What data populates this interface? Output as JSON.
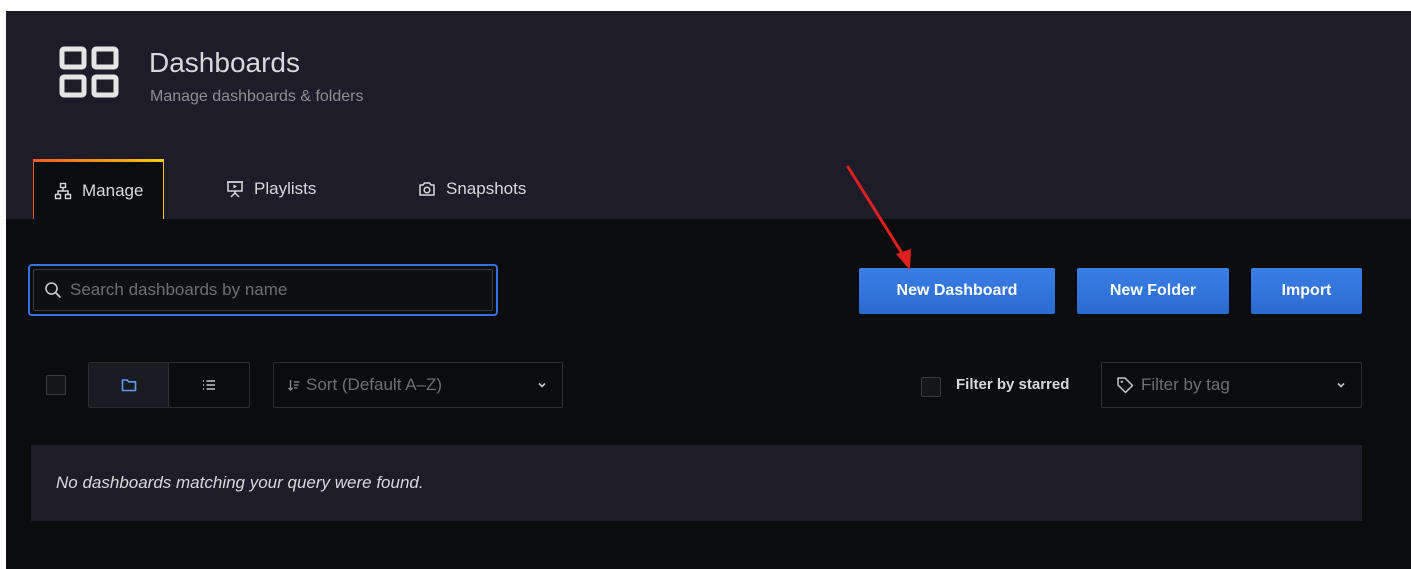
{
  "header": {
    "title": "Dashboards",
    "subtitle": "Manage dashboards & folders",
    "icon": "dashboards-grid-icon"
  },
  "tabs": [
    {
      "label": "Manage",
      "icon": "sitemap-icon",
      "active": true
    },
    {
      "label": "Playlists",
      "icon": "presentation-icon",
      "active": false
    },
    {
      "label": "Snapshots",
      "icon": "camera-icon",
      "active": false
    }
  ],
  "search": {
    "placeholder": "Search dashboards by name",
    "value": ""
  },
  "actions": {
    "new_dashboard": "New Dashboard",
    "new_folder": "New Folder",
    "import": "Import"
  },
  "toolbar": {
    "sort_label": "Sort (Default A–Z)",
    "filter_starred_label": "Filter by starred",
    "filter_tag_placeholder": "Filter by tag",
    "view_modes": [
      "folder-view",
      "list-view"
    ],
    "active_view": "folder-view"
  },
  "empty_state": {
    "message": "No dashboards matching your query were found."
  },
  "colors": {
    "header_bg": "#1f1c2a",
    "body_bg": "#0b0c0e",
    "primary_button": "#3274d9",
    "focus_border": "#3871dc",
    "annotation_arrow": "#e02020"
  }
}
